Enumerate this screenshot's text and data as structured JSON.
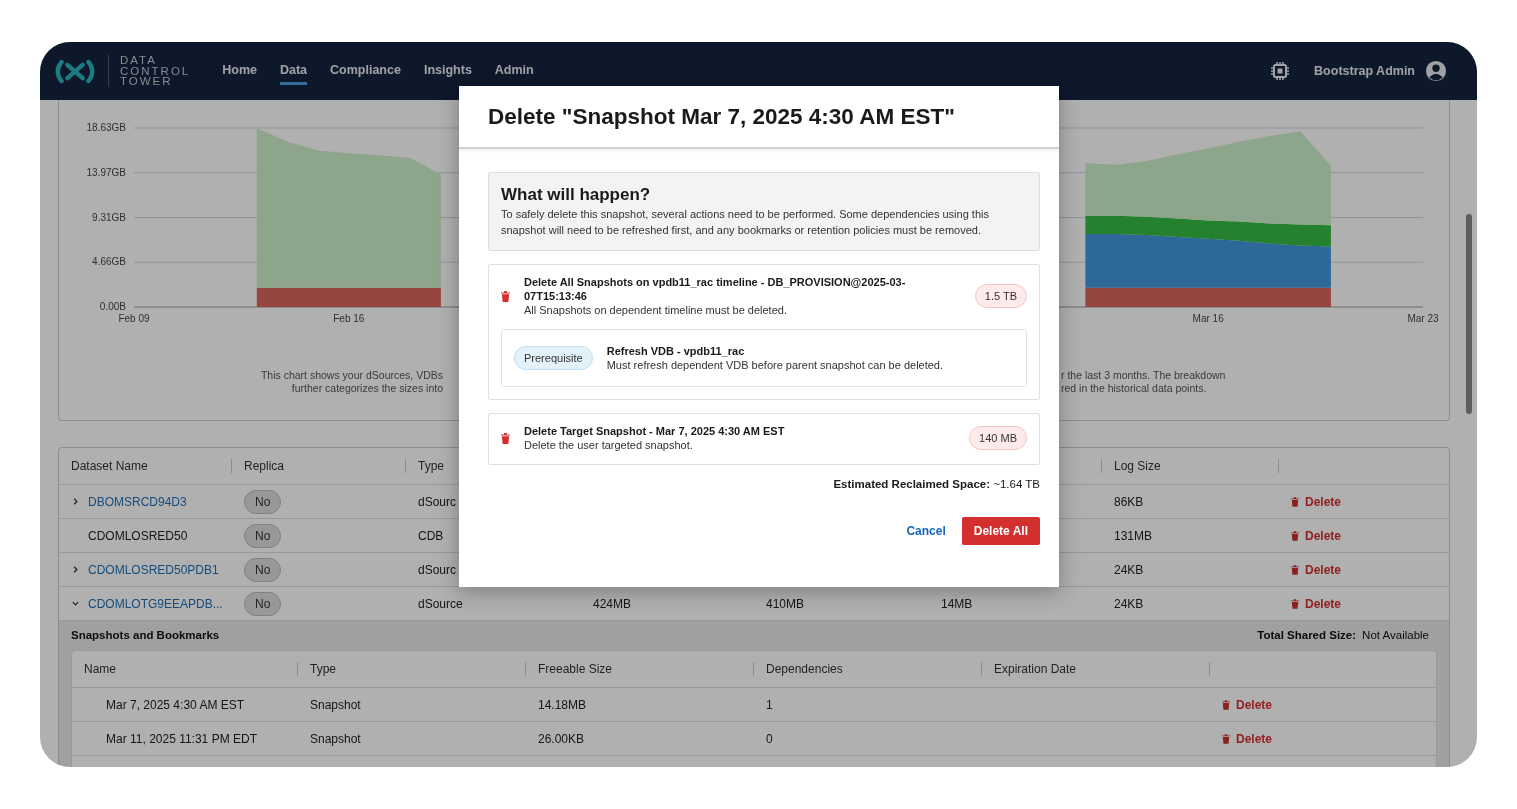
{
  "navbar": {
    "brand_lines": [
      "DATA",
      "CONTROL",
      "TOWER"
    ],
    "nav_items": [
      {
        "label": "Home",
        "selected": false
      },
      {
        "label": "Data",
        "selected": true
      },
      {
        "label": "Compliance",
        "selected": false
      },
      {
        "label": "Insights",
        "selected": false
      },
      {
        "label": "Admin",
        "selected": false
      }
    ],
    "user_name": "Bootstrap Admin"
  },
  "chart_card": {
    "chart_data": {
      "type": "area",
      "stacked": true,
      "categories": [
        "Feb 09",
        null,
        null,
        null,
        null,
        null,
        null,
        "Feb 16",
        null,
        null,
        null,
        null,
        null,
        null,
        null,
        null,
        null,
        null,
        null,
        null,
        null,
        null,
        null,
        null,
        null,
        null,
        null,
        null,
        null,
        null,
        null,
        null,
        null,
        null,
        null,
        "Mar 16",
        null,
        null,
        null,
        null,
        null,
        null,
        "Mar 23"
      ],
      "yticks": [
        {
          "value": 0,
          "label": "0.00B"
        },
        {
          "value": 4.66,
          "label": "4.66GB"
        },
        {
          "value": 9.31,
          "label": "9.31GB"
        },
        {
          "value": 13.97,
          "label": "13.97GB"
        },
        {
          "value": 18.63,
          "label": "18.63GB"
        }
      ],
      "grid": true,
      "ylim": [
        0,
        18.63
      ],
      "series": [
        {
          "color": "#96453f",
          "values": [
            null,
            null,
            null,
            null,
            2,
            2,
            2,
            2,
            2,
            2,
            2,
            null,
            null,
            null,
            null,
            null,
            null,
            null,
            null,
            null,
            null,
            null,
            null,
            null,
            null,
            null,
            null,
            null,
            null,
            null,
            null,
            2,
            2,
            2,
            2,
            2,
            2,
            2,
            2,
            2,
            null,
            null,
            null
          ]
        },
        {
          "color": "#2e6899",
          "values": [
            null,
            null,
            null,
            null,
            null,
            null,
            null,
            null,
            null,
            null,
            null,
            null,
            null,
            null,
            null,
            null,
            null,
            null,
            null,
            null,
            null,
            null,
            null,
            null,
            null,
            null,
            null,
            null,
            null,
            null,
            null,
            5.6,
            5.6,
            5.5,
            5.3,
            5.1,
            4.9,
            4.6,
            4.4,
            4.3,
            null,
            null,
            null
          ]
        },
        {
          "color": "#24822f",
          "values": [
            null,
            null,
            null,
            null,
            null,
            null,
            null,
            null,
            null,
            null,
            null,
            null,
            null,
            null,
            null,
            null,
            null,
            null,
            null,
            null,
            null,
            null,
            null,
            null,
            null,
            null,
            null,
            null,
            null,
            null,
            null,
            1.9,
            1.9,
            1.9,
            1.9,
            1.9,
            2.0,
            2.1,
            2.2,
            2.2,
            null,
            null,
            null
          ]
        },
        {
          "color": "#8da58a",
          "values": [
            null,
            null,
            null,
            null,
            16.6,
            15.2,
            14.3,
            14.0,
            13.8,
            13.5,
            11.8,
            null,
            null,
            null,
            null,
            null,
            null,
            null,
            null,
            null,
            null,
            null,
            null,
            null,
            null,
            null,
            null,
            null,
            null,
            null,
            null,
            5.5,
            5.3,
            5.8,
            6.7,
            7.5,
            8.3,
            9.1,
            9.7,
            6.2,
            null,
            null,
            null
          ]
        }
      ]
    },
    "caption_left": [
      "This chart shows your dSources, VDBs",
      "further categorizes the sizes into"
    ],
    "caption_right": [
      "r the last 3 months. The breakdown",
      "red in the historical data points."
    ]
  },
  "datasets_table": {
    "columns": [
      "Dataset Name",
      "Replica",
      "Type",
      "",
      "",
      "",
      "Log Size",
      ""
    ],
    "rows": [
      {
        "expandable": true,
        "expanded": false,
        "name": "DBOMSRCD94D3",
        "replica": "No",
        "type": "dSourc",
        "column_4": "",
        "column_5": "",
        "column_6": "",
        "log_size": "86KB",
        "action": "Delete"
      },
      {
        "expandable": false,
        "expanded": false,
        "name": "CDOMLOSRED50",
        "replica": "No",
        "type": "CDB",
        "column_4": "",
        "column_5": "",
        "column_6": "",
        "log_size": "131MB",
        "action": "Delete"
      },
      {
        "expandable": true,
        "expanded": false,
        "name": "CDOMLOSRED50PDB1",
        "replica": "No",
        "type": "dSourc",
        "column_4": "",
        "column_5": "",
        "column_6": "",
        "log_size": "24KB",
        "action": "Delete"
      },
      {
        "expandable": true,
        "expanded": true,
        "name": "CDOMLOTG9EEAPDB...",
        "replica": "No",
        "type": "dSource",
        "column_4": "424MB",
        "column_5": "410MB",
        "column_6": "14MB",
        "log_size": "24KB",
        "action": "Delete"
      }
    ]
  },
  "snapshots_panel": {
    "title": "Snapshots and Bookmarks",
    "total_label": "Total Shared Size:",
    "total_value": "Not Available",
    "columns": [
      "Name",
      "Type",
      "Freeable Size",
      "Dependencies",
      "Expiration Date"
    ],
    "rows": [
      {
        "name": "Mar 7, 2025 4:30 AM EST",
        "type": "Snapshot",
        "freeable_size": "14.18MB",
        "dependencies": "1",
        "expiration_date": "",
        "action": "Delete"
      },
      {
        "name": "Mar 11, 2025 11:31 PM EDT",
        "type": "Snapshot",
        "freeable_size": "26.00KB",
        "dependencies": "0",
        "expiration_date": "",
        "action": "Delete"
      }
    ]
  },
  "dialog": {
    "title": "Delete \"Snapshot Mar 7, 2025 4:30 AM EST\"",
    "info_title": "What will happen?",
    "info_text": "To safely delete this snapshot, several actions need to be performed. Some dependencies using this snapshot will need to be refreshed first, and any bookmarks or retention policies must be removed.",
    "steps": [
      {
        "title": "Delete All Snapshots on vpdb11_rac timeline - DB_PROVISION@2025-03-07T15:13:46",
        "description": "All Snapshots on dependent timeline must be deleted.",
        "size": "1.5 TB",
        "prerequisites": [
          {
            "label": "Prerequisite",
            "title": "Refresh VDB - vpdb11_rac",
            "description": "Must refresh dependent VDB before parent snapshot can be deleted."
          }
        ]
      },
      {
        "title": "Delete Target Snapshot - Mar 7, 2025 4:30 AM EST",
        "description": "Delete the user targeted snapshot.",
        "size": "140 MB"
      }
    ],
    "estimate_label": "Estimated Reclaimed Space:",
    "estimate_value": "~1.64 TB",
    "buttons": [
      {
        "kind": "link",
        "label": "Cancel"
      },
      {
        "kind": "danger",
        "label": "Delete All"
      }
    ]
  }
}
